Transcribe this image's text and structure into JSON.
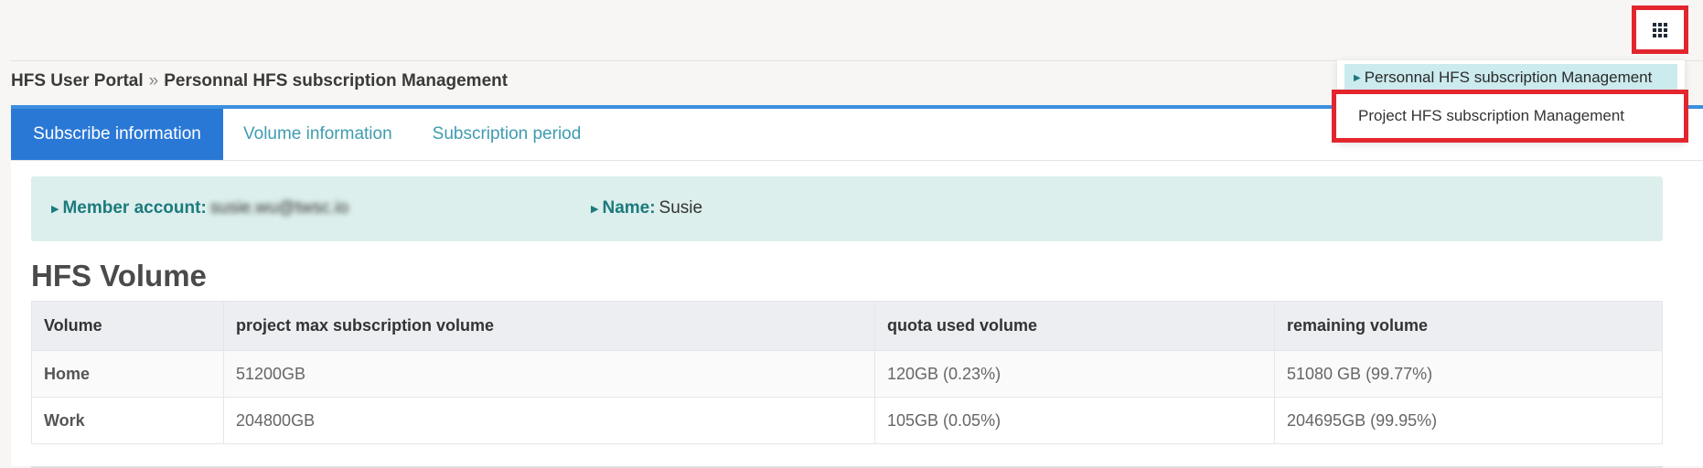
{
  "breadcrumb": {
    "root": "HFS User Portal",
    "separator": "»",
    "current": "Personnal HFS subscription Management"
  },
  "tabs": [
    {
      "label": "Subscribe information",
      "active": true
    },
    {
      "label": "Volume information",
      "active": false
    },
    {
      "label": "Subscription period",
      "active": false
    }
  ],
  "member": {
    "account_label": "Member account:",
    "account_value": "susie.wu@twsc.io",
    "name_label": "Name:",
    "name_value": "Susie"
  },
  "section": {
    "title": "HFS Volume"
  },
  "table": {
    "headers": [
      "Volume",
      "project max subscription volume",
      "quota used volume",
      "remaining volume"
    ],
    "rows": [
      [
        "Home",
        "51200GB",
        "120GB (0.23%)",
        "51080 GB (99.77%)"
      ],
      [
        "Work",
        "204800GB",
        "105GB (0.05%)",
        "204695GB (99.95%)"
      ]
    ]
  },
  "menu": {
    "items": [
      {
        "label": "Personnal HFS subscription Management",
        "selected": true
      },
      {
        "label": "Project HFS subscription Management",
        "selected": false
      }
    ]
  },
  "colors": {
    "accent": "#2a78d6",
    "highlight_box": "#e3262d",
    "member_bar_bg": "#dcefec",
    "tab_text": "#3f9cb0"
  }
}
